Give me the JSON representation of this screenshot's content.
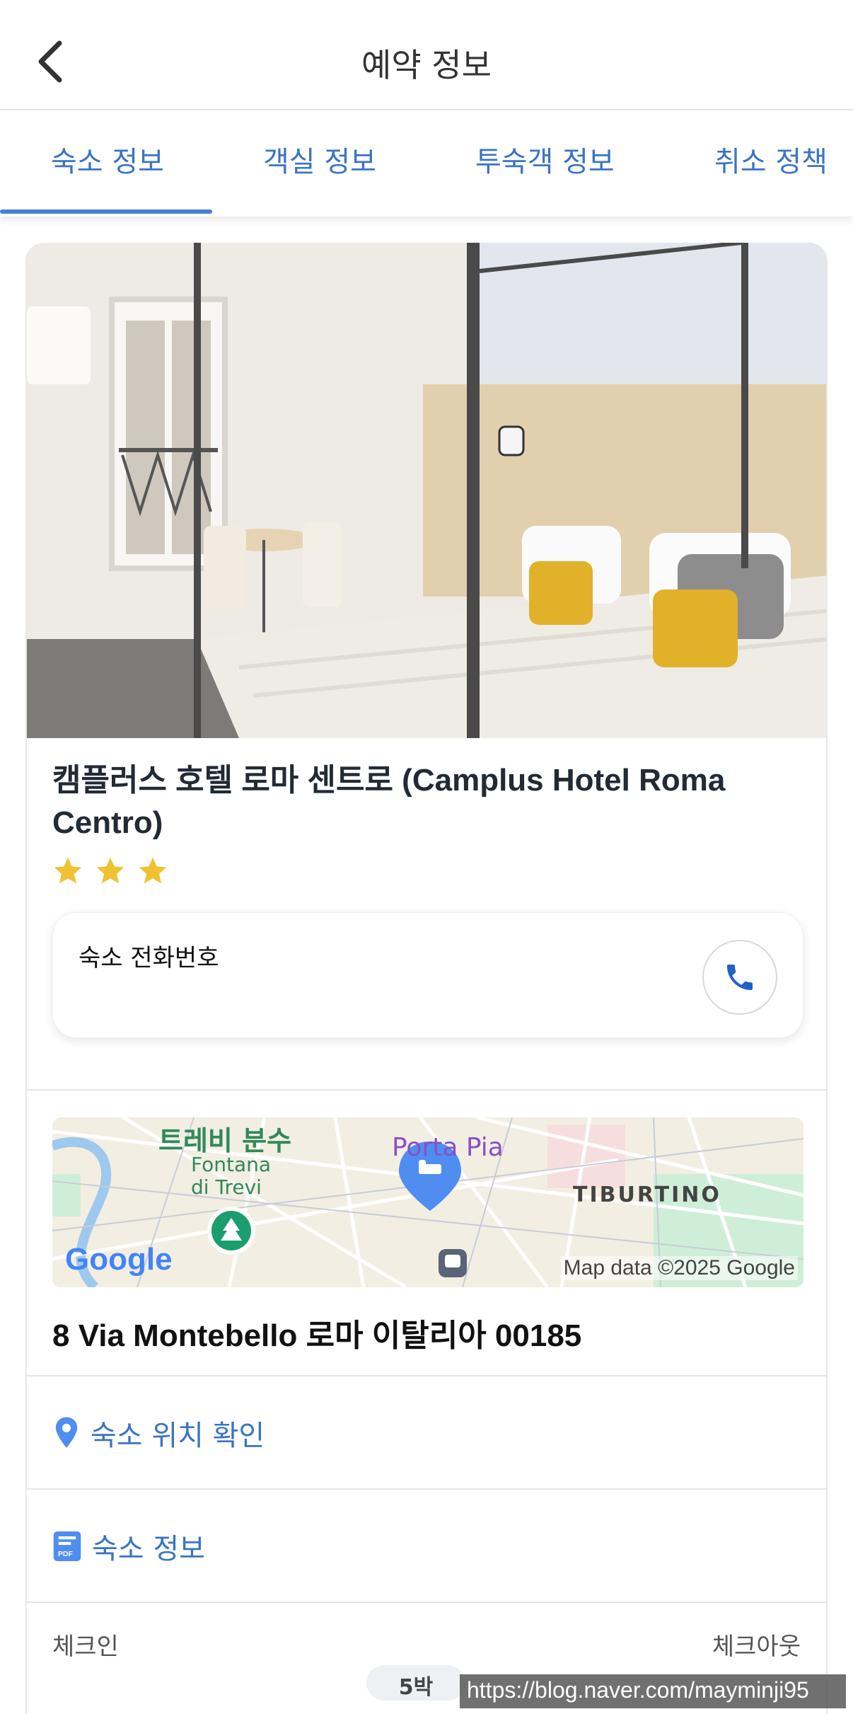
{
  "header": {
    "title": "예약 정보"
  },
  "tabs": [
    {
      "label": "숙소 정보",
      "active": true
    },
    {
      "label": "객실 정보",
      "active": false
    },
    {
      "label": "투숙객 정보",
      "active": false
    },
    {
      "label": "취소 정책",
      "active": false
    }
  ],
  "hotel": {
    "name": "캠플러스 호텔 로마 센트로 (Camplus Hotel Roma Centro)",
    "star_rating": 3,
    "phone_label": "숙소 전화번호",
    "address": "8 Via Montebello 로마 이탈리아 00185"
  },
  "map": {
    "label_trevi_ko": "트레비 분수",
    "label_trevi_it_1": "Fontana",
    "label_trevi_it_2": "di Trevi",
    "label_porta_pia": "Porta Pia",
    "label_tiburtino": "TIBURTINO",
    "google_logo": "Google",
    "attribution": "Map data ©2025 Google"
  },
  "links": {
    "location": "숙소 위치 확인",
    "info": "숙소 정보"
  },
  "stay": {
    "checkin_label": "체크인",
    "checkout_label": "체크아웃",
    "nights": "5박"
  },
  "watermark": "https://blog.naver.com/mayminji95",
  "colors": {
    "accent": "#3a74c4",
    "star": "#f0c232",
    "pin": "#4f8ef0"
  }
}
